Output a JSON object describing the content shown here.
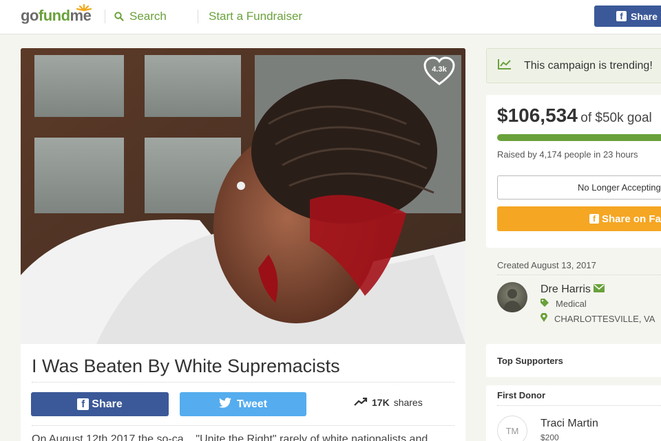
{
  "header": {
    "logo": {
      "go": "go",
      "fund": "fund",
      "me": "me"
    },
    "search_label": "Search",
    "start_label": "Start a Fundraiser",
    "share_label": "Share"
  },
  "campaign": {
    "likes": "4.3k",
    "title": "I Was Beaten By White Supremacists",
    "share_fb_label": "Share",
    "tweet_label": "Tweet",
    "shares_count": "17K",
    "shares_suffix": "shares",
    "story_excerpt": "On August 12th 2017 the so-ca... \"Unite the Right\" rarely of white nationalists and"
  },
  "sidebar": {
    "trending_text": "This campaign is trending!",
    "amount": "$106,534",
    "goal_text": "of $50k goal",
    "progress_fraction": 1.0,
    "raised_text": "Raised by 4,174 people in 23 hours",
    "no_longer_label": "No Longer Accepting",
    "share_big_label": "Share on Fac",
    "created_text": "Created August 13, 2017",
    "organizer": {
      "name": "Dre Harris",
      "category": "Medical",
      "location": "CHARLOTTESVILLE, VA"
    },
    "top_supporters_label": "Top Supporters",
    "first_donor_label": "First Donor",
    "first_donor": {
      "initials": "TM",
      "name": "Traci Martin",
      "amount": "$200"
    }
  },
  "colors": {
    "brand_green": "#6aa13b",
    "facebook_blue": "#3b5998",
    "twitter_blue": "#55acee",
    "orange": "#f5a623"
  }
}
